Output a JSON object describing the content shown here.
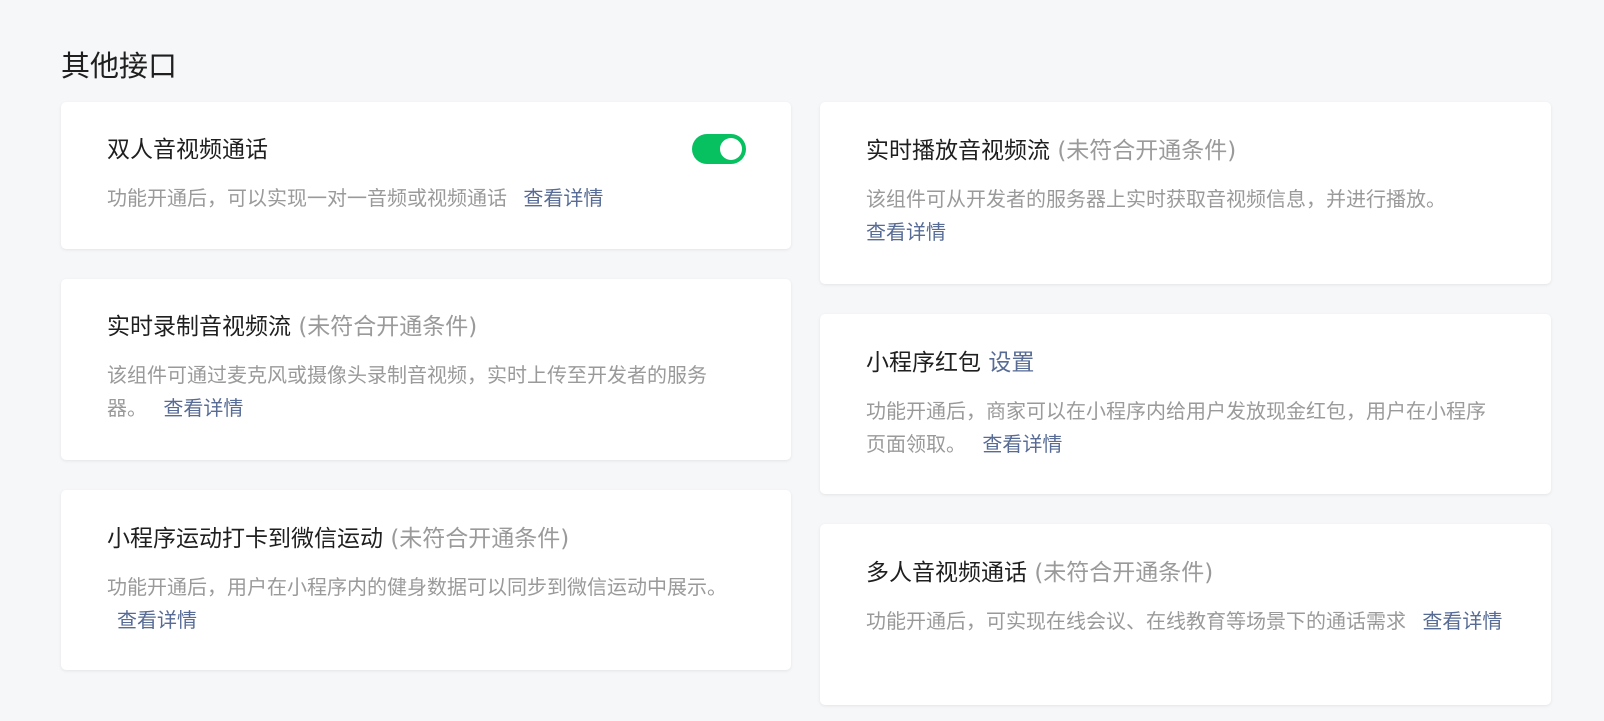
{
  "section": {
    "title": "其他接口"
  },
  "cards": {
    "dual_av_call": {
      "title": "双人音视频通话",
      "toggle_on": true,
      "desc": "功能开通后，可以实现一对一音频或视频通话",
      "link": "查看详情"
    },
    "live_record": {
      "title": "实时录制音视频流",
      "condition": "(未符合开通条件)",
      "desc": "该组件可通过麦克风或摄像头录制音视频，实时上传至开发者的服务器。",
      "link": "查看详情"
    },
    "sport_checkin": {
      "title": "小程序运动打卡到微信运动",
      "condition": "(未符合开通条件)",
      "desc": "功能开通后，用户在小程序内的健身数据可以同步到微信运动中展示。",
      "link": "查看详情"
    },
    "live_play": {
      "title": "实时播放音视频流",
      "condition": "(未符合开通条件)",
      "desc": "该组件可从开发者的服务器上实时获取音视频信息，并进行播放。",
      "link": "查看详情"
    },
    "red_packet": {
      "title": "小程序红包",
      "setting_link": "设置",
      "desc": "功能开通后，商家可以在小程序内给用户发放现金红包，用户在小程序页面领取。",
      "link": "查看详情"
    },
    "multi_av_call": {
      "title": "多人音视频通话",
      "condition": "(未符合开通条件)",
      "desc": "功能开通后，可实现在线会议、在线教育等场景下的通话需求",
      "link": "查看详情"
    }
  },
  "colors": {
    "accent_green": "#07c160",
    "link_blue": "#576b95",
    "muted_gray": "#9a9a9a",
    "background": "#f6f7f9"
  }
}
